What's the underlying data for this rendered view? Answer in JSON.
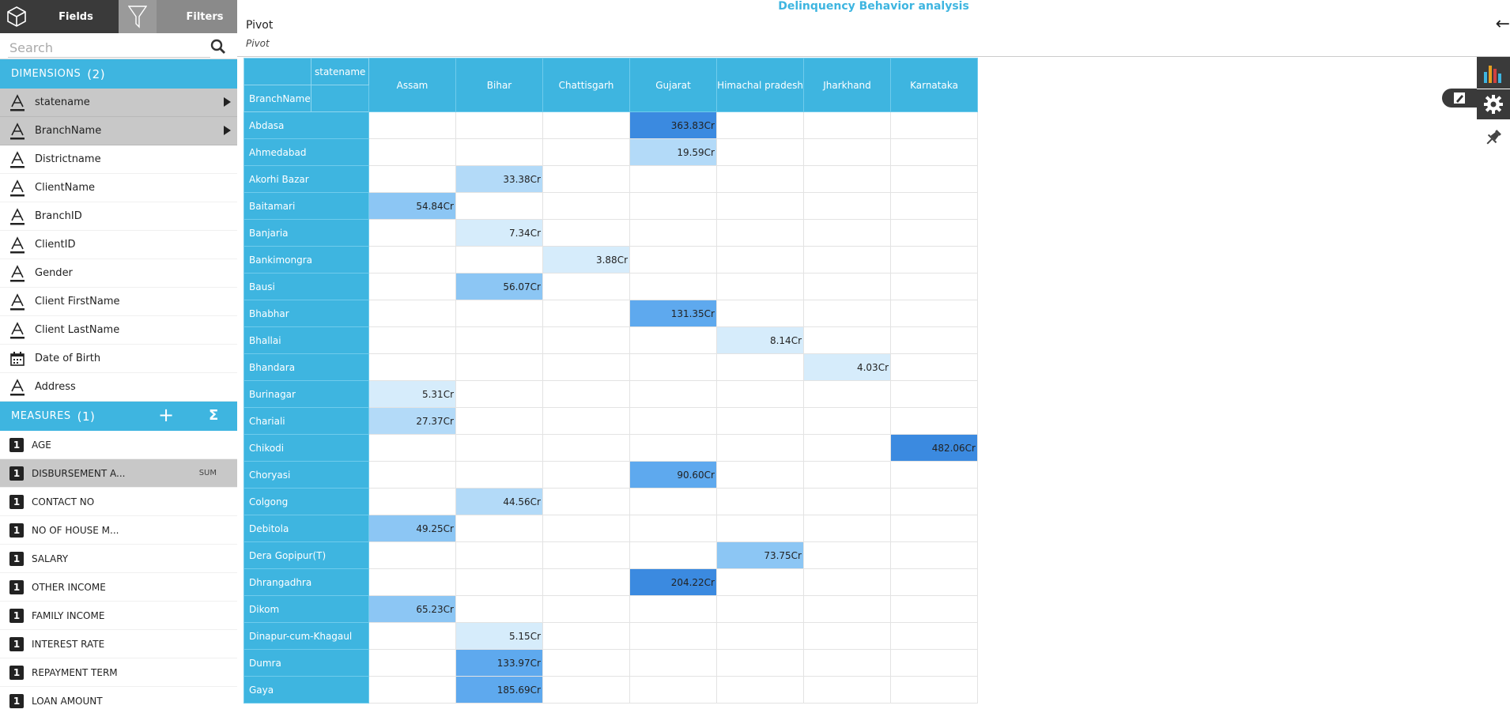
{
  "left_panel": {
    "tabs": {
      "fields": "Fields",
      "filters": "Filters"
    },
    "search": {
      "placeholder": "Search"
    },
    "dimensions": {
      "label": "DIMENSIONS",
      "count": "(2)",
      "items": [
        {
          "label": "statename",
          "icon": "text-icon",
          "selected": true
        },
        {
          "label": "BranchName",
          "icon": "text-icon",
          "selected": true
        },
        {
          "label": "Districtname",
          "icon": "text-icon"
        },
        {
          "label": "ClientName",
          "icon": "text-icon"
        },
        {
          "label": "BranchID",
          "icon": "text-icon"
        },
        {
          "label": "ClientID",
          "icon": "text-icon"
        },
        {
          "label": "Gender",
          "icon": "text-icon"
        },
        {
          "label": "Client FirstName",
          "icon": "text-icon"
        },
        {
          "label": "Client LastName",
          "icon": "text-icon"
        },
        {
          "label": "Date of Birth",
          "icon": "calendar-icon"
        },
        {
          "label": "Address",
          "icon": "text-icon"
        }
      ]
    },
    "measures": {
      "label": "MEASURES",
      "count": "(1)",
      "plus": "+",
      "sigma": "Σ",
      "items": [
        {
          "label": "AGE",
          "badge": "1"
        },
        {
          "label": "DISBURSEMENT A...",
          "badge": "1",
          "agg": "SUM",
          "selected": true
        },
        {
          "label": "CONTACT NO",
          "badge": "1"
        },
        {
          "label": "NO OF HOUSE M...",
          "badge": "1"
        },
        {
          "label": "SALARY",
          "badge": "1"
        },
        {
          "label": "OTHER INCOME",
          "badge": "1"
        },
        {
          "label": "FAMILY INCOME",
          "badge": "1"
        },
        {
          "label": "INTEREST RATE",
          "badge": "1"
        },
        {
          "label": "REPAYMENT TERM",
          "badge": "1"
        },
        {
          "label": "LOAN AMOUNT",
          "badge": "1"
        }
      ]
    }
  },
  "main": {
    "title": "Delinquency Behavior analysis",
    "pivot_title": "Pivot",
    "pivot_subtitle": "Pivot",
    "back_arrow": "←"
  },
  "pivot": {
    "column_field": "statename",
    "row_field": "BranchName",
    "columns": [
      "Assam",
      "Bihar",
      "Chattisgarh",
      "Gujarat",
      "Himachal pradesh",
      "Jharkhand",
      "Karnataka"
    ],
    "rows": [
      {
        "name": "Abdasa",
        "values": [
          "",
          "",
          "",
          "363.83Cr",
          "",
          "",
          ""
        ]
      },
      {
        "name": "Ahmedabad",
        "values": [
          "",
          "",
          "",
          "19.59Cr",
          "",
          "",
          ""
        ]
      },
      {
        "name": "Akorhi Bazar",
        "values": [
          "",
          "33.38Cr",
          "",
          "",
          "",
          "",
          ""
        ]
      },
      {
        "name": "Baitamari",
        "values": [
          "54.84Cr",
          "",
          "",
          "",
          "",
          "",
          ""
        ]
      },
      {
        "name": "Banjaria",
        "values": [
          "",
          "7.34Cr",
          "",
          "",
          "",
          "",
          ""
        ]
      },
      {
        "name": "Bankimongra",
        "values": [
          "",
          "",
          "3.88Cr",
          "",
          "",
          "",
          ""
        ]
      },
      {
        "name": "Bausi",
        "values": [
          "",
          "56.07Cr",
          "",
          "",
          "",
          "",
          ""
        ]
      },
      {
        "name": "Bhabhar",
        "values": [
          "",
          "",
          "",
          "131.35Cr",
          "",
          "",
          ""
        ]
      },
      {
        "name": "Bhallai",
        "values": [
          "",
          "",
          "",
          "",
          "8.14Cr",
          "",
          ""
        ]
      },
      {
        "name": "Bhandara",
        "values": [
          "",
          "",
          "",
          "",
          "",
          "4.03Cr",
          ""
        ]
      },
      {
        "name": "Burinagar",
        "values": [
          "5.31Cr",
          "",
          "",
          "",
          "",
          "",
          ""
        ]
      },
      {
        "name": "Chariali",
        "values": [
          "27.37Cr",
          "",
          "",
          "",
          "",
          "",
          ""
        ]
      },
      {
        "name": "Chikodi",
        "values": [
          "",
          "",
          "",
          "",
          "",
          "",
          "482.06Cr"
        ]
      },
      {
        "name": "Choryasi",
        "values": [
          "",
          "",
          "",
          "90.60Cr",
          "",
          "",
          ""
        ]
      },
      {
        "name": "Colgong",
        "values": [
          "",
          "44.56Cr",
          "",
          "",
          "",
          "",
          ""
        ]
      },
      {
        "name": "Debitola",
        "values": [
          "49.25Cr",
          "",
          "",
          "",
          "",
          "",
          ""
        ]
      },
      {
        "name": "Dera Gopipur(T)",
        "values": [
          "",
          "",
          "",
          "",
          "73.75Cr",
          "",
          ""
        ]
      },
      {
        "name": "Dhrangadhra",
        "values": [
          "",
          "",
          "",
          "204.22Cr",
          "",
          "",
          ""
        ]
      },
      {
        "name": "Dikom",
        "values": [
          "65.23Cr",
          "",
          "",
          "",
          "",
          "",
          ""
        ]
      },
      {
        "name": "Dinapur-cum-Khagaul",
        "values": [
          "",
          "5.15Cr",
          "",
          "",
          "",
          "",
          ""
        ]
      },
      {
        "name": "Dumra",
        "values": [
          "",
          "133.97Cr",
          "",
          "",
          "",
          "",
          ""
        ]
      },
      {
        "name": "Gaya",
        "values": [
          "",
          "185.69Cr",
          "",
          "",
          "",
          "",
          ""
        ]
      }
    ],
    "heat_colors": [
      "#d6ecfb",
      "#b3daf8",
      "#8cc6f4",
      "#5ea9ee",
      "#3b8ae0"
    ]
  },
  "colors": {
    "accent": "#3eb5e0",
    "dark": "#3a3a3a",
    "selected": "#c8c8c8"
  }
}
